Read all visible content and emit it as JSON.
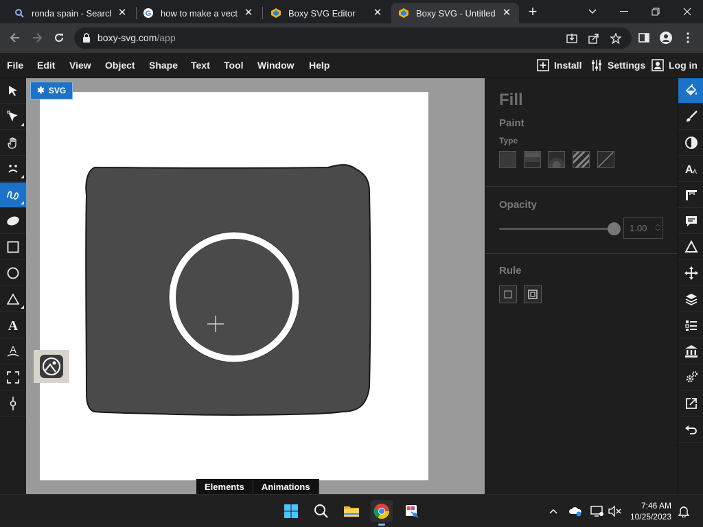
{
  "browser": {
    "tabs": [
      {
        "label": "ronda spain - Search",
        "icon": "search-icon"
      },
      {
        "label": "how to make a vector i",
        "icon": "google-icon"
      },
      {
        "label": "Boxy SVG Editor",
        "icon": "boxy-svg-icon"
      },
      {
        "label": "Boxy SVG - Untitled [Ec",
        "icon": "boxy-svg-icon",
        "active": true
      }
    ],
    "new_tab": "+",
    "url_host": "boxy-svg.com",
    "url_path": "/app"
  },
  "menubar": {
    "items": [
      "File",
      "Edit",
      "View",
      "Object",
      "Shape",
      "Text",
      "Tool",
      "Window",
      "Help"
    ],
    "install": "Install",
    "settings": "Settings",
    "login": "Log in"
  },
  "canvas": {
    "badge": "SVG",
    "bottom_tabs": [
      "Elements",
      "Animations"
    ],
    "shape_fill": "#4a4a4a",
    "artboard_bg": "#ffffff",
    "workspace_bg": "#9a9a9a"
  },
  "fill_panel": {
    "title": "Fill",
    "paint_section": "Paint",
    "type_label": "Type",
    "opacity_section": "Opacity",
    "opacity_value": "1.00",
    "opacity_level": 1.0,
    "rule_section": "Rule"
  },
  "tools": [
    "pointer-tool",
    "node-edit-tool",
    "pan-tool",
    "face-tool",
    "freehand-tool",
    "ellipse-blob-tool",
    "rectangle-tool",
    "circle-tool",
    "triangle-tool",
    "text-tool",
    "text-path-tool",
    "crop-tool",
    "node-tool"
  ],
  "side_panels": [
    "fill-panel",
    "stroke-panel",
    "contrast-panel",
    "typography-panel",
    "ruler-panel",
    "comment-panel",
    "shape-panel",
    "transform-panel",
    "layers-panel",
    "list-panel",
    "library-panel",
    "settings-panel",
    "export-panel",
    "undo-panel"
  ],
  "taskbar": {
    "time": "7:46 AM",
    "date": "10/25/2023"
  },
  "colors": {
    "accent": "#1a73c9",
    "app_bg": "#1e1e1e"
  }
}
